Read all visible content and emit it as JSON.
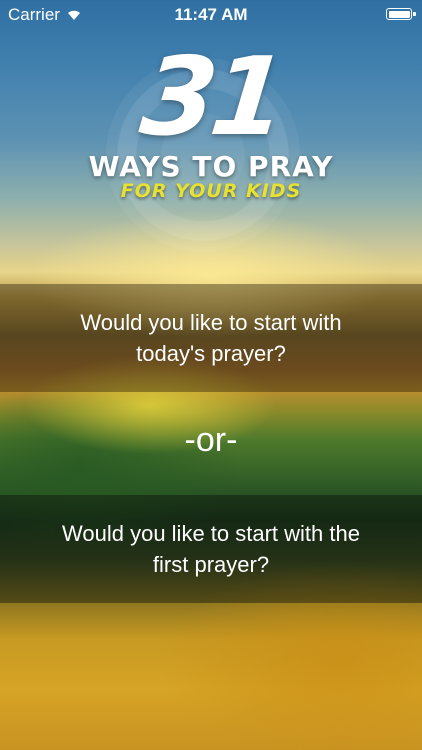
{
  "statusbar": {
    "carrier": "Carrier",
    "time": "11:47 AM",
    "battery_level": 1.0
  },
  "logo": {
    "number": "31",
    "line1": "WAYS TO PRAY",
    "line2": "FOR YOUR KIDS",
    "accent_color": "#e8e130"
  },
  "options": {
    "today": "Would you like to start with today's prayer?",
    "separator": "-or-",
    "first": "Would you like to start with the first prayer?"
  }
}
